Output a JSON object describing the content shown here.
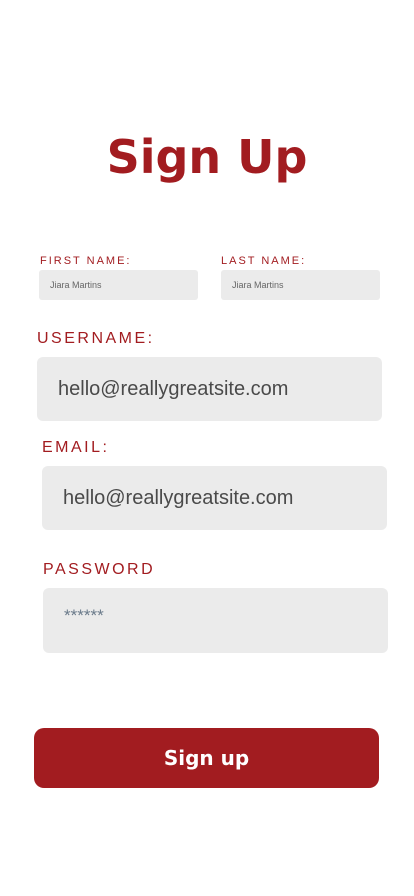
{
  "title": "Sign Up",
  "first_name": {
    "label": "FIRST NAME:",
    "value": "Jiara Martins"
  },
  "last_name": {
    "label": "LAST NAME:",
    "value": "Jiara Martins"
  },
  "username": {
    "label": "USERNAME:",
    "value": "hello@reallygreatsite.com"
  },
  "email": {
    "label": "EMAIL:",
    "value": "hello@reallygreatsite.com"
  },
  "password": {
    "label": "PASSWORD",
    "value": "******"
  },
  "submit_label": "Sign up",
  "colors": {
    "accent": "#a21c20",
    "field_bg": "#ebebeb"
  }
}
